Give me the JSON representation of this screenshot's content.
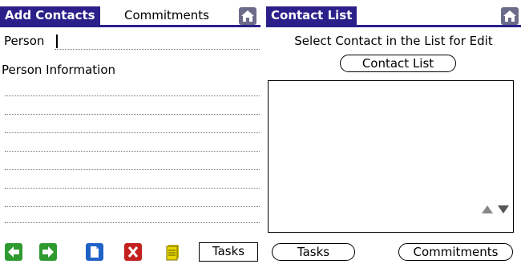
{
  "left_panel": {
    "tabs": {
      "active": "Add Contacts",
      "inactive": "Commitments"
    },
    "person_label": "Person",
    "person_value": "",
    "info_label": "Person Information"
  },
  "right_panel": {
    "title": "Contact List",
    "instruction": "Select Contact in the List for Edit",
    "contact_list_button": "Contact List"
  },
  "toolbar": {
    "left_tasks": "Tasks",
    "right_tasks": "Tasks",
    "commitments": "Commitments"
  },
  "icons": [
    "home-icon",
    "back-arrow-icon",
    "forward-arrow-icon",
    "new-document-icon",
    "delete-icon",
    "notes-icon",
    "scroll-up-icon",
    "scroll-down-icon"
  ],
  "colors": {
    "title_bar": "#2b1f8a",
    "green": "#2f9a2f",
    "blue": "#1f62c6",
    "red": "#c42020",
    "yellow": "#c8b400"
  }
}
